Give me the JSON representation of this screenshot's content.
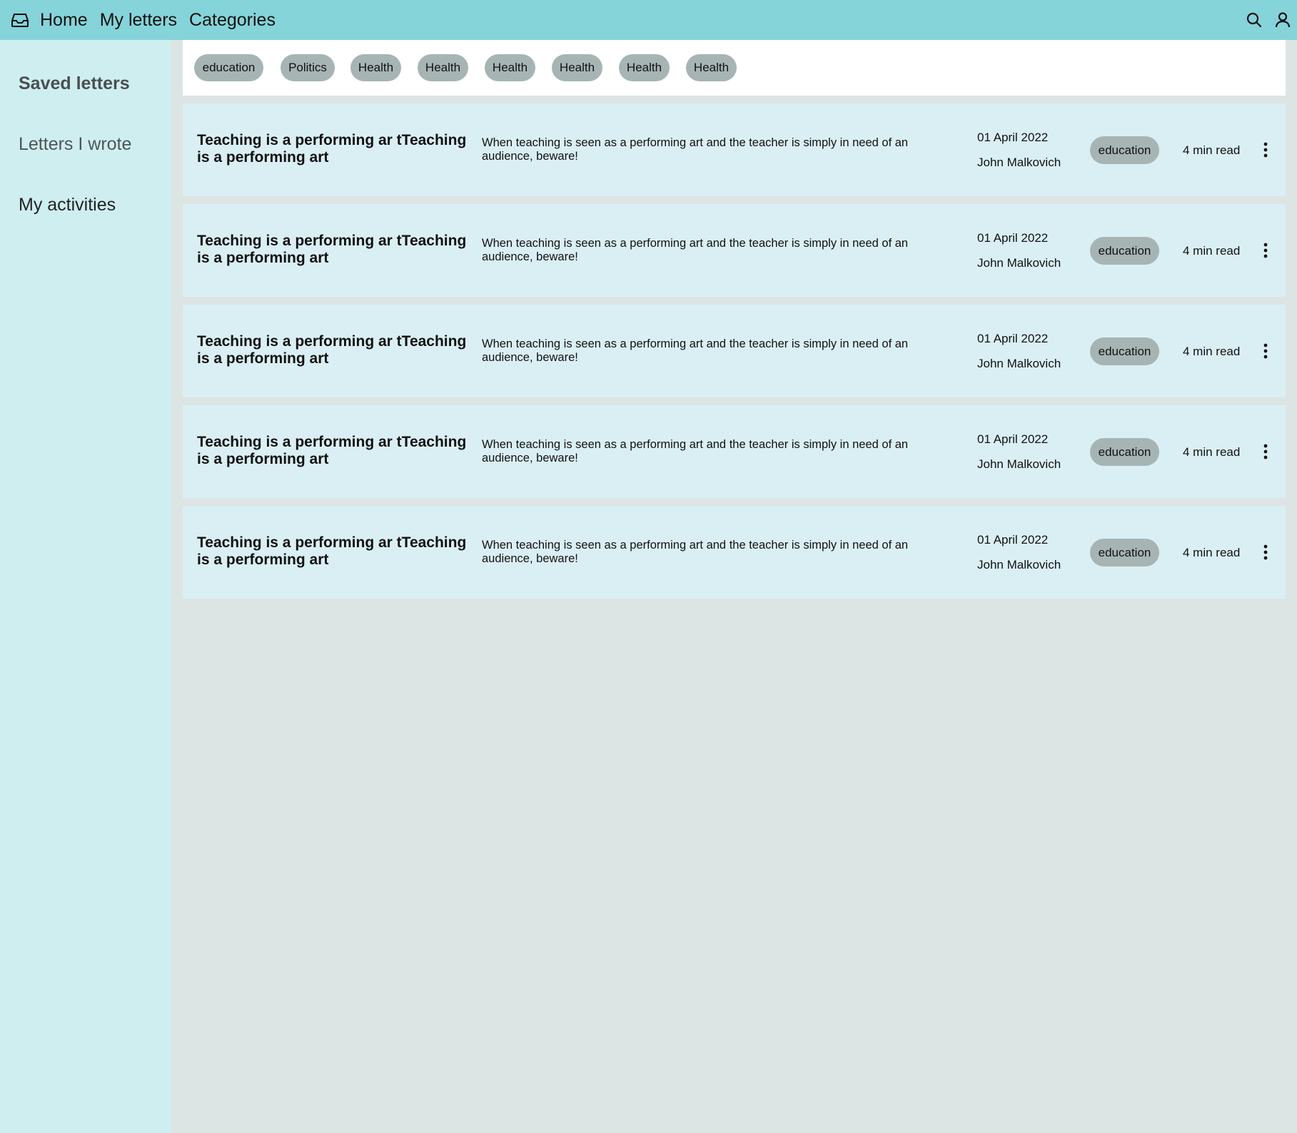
{
  "nav": {
    "logo_icon": "inbox-icon",
    "links": [
      "Home",
      "My letters",
      "Categories"
    ],
    "search_icon": "search-icon",
    "user_icon": "user-icon"
  },
  "sidebar": {
    "items": [
      {
        "label": "Saved letters",
        "active": true
      },
      {
        "label": "Letters I wrote",
        "active": false
      },
      {
        "label": "My activities",
        "active": false
      }
    ]
  },
  "filters": {
    "chips": [
      "education",
      "Politics",
      "Health",
      "Health",
      "Health",
      "Health",
      "Health",
      "Health"
    ]
  },
  "letters": [
    {
      "title": "Teaching is a performing ar tTeaching is a performing art",
      "excerpt": "When teaching is seen as a performing art and the teacher is simply in need of an audience, beware!",
      "date": "01  April 2022",
      "author": "John Malkovich",
      "category": "education",
      "read_time": "4 min read"
    },
    {
      "title": "Teaching is a performing ar tTeaching is a performing art",
      "excerpt": "When teaching is seen as a performing art and the teacher is simply in need of an audience, beware!",
      "date": "01  April 2022",
      "author": "John Malkovich",
      "category": "education",
      "read_time": "4 min read"
    },
    {
      "title": "Teaching is a performing ar tTeaching is a performing art",
      "excerpt": "When teaching is seen as a performing art and the teacher is simply in need of an audience, beware!",
      "date": "01  April 2022",
      "author": "John Malkovich",
      "category": "education",
      "read_time": "4 min read"
    },
    {
      "title": "Teaching is a performing ar tTeaching is a performing art",
      "excerpt": "When teaching is seen as a performing art and the teacher is simply in need of an audience, beware!",
      "date": "01  April 2022",
      "author": "John Malkovich",
      "category": "education",
      "read_time": "4 min read"
    },
    {
      "title": "Teaching is a performing ar tTeaching is a performing art",
      "excerpt": "When teaching is seen as a performing art and the teacher is simply in need of an audience, beware!",
      "date": "01  April 2022",
      "author": "John Malkovich",
      "category": "education",
      "read_time": "4 min read"
    }
  ],
  "colors": {
    "topbar": "#85d4d9",
    "sidebar": "#cfeef0",
    "card": "#daeff4",
    "chip": "#a6b5b4",
    "page": "#dde4e4"
  }
}
